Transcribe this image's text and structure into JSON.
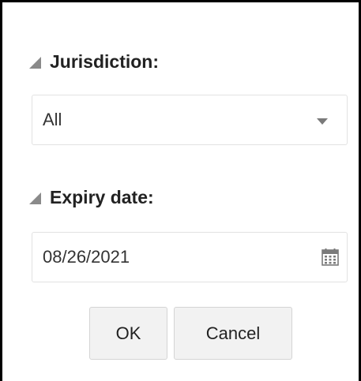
{
  "filters": {
    "jurisdiction": {
      "label": "Jurisdiction:",
      "selected_value": "All"
    },
    "expiry_date": {
      "label": "Expiry date:",
      "value": "08/26/2021"
    }
  },
  "buttons": {
    "ok_label": "OK",
    "cancel_label": "Cancel"
  },
  "icons": {
    "collapse": "triangle-collapse-icon",
    "dropdown": "chevron-down-icon",
    "calendar": "calendar-icon"
  },
  "colors": {
    "label_text": "#222222",
    "icon_gray": "#7a7a7a",
    "button_bg": "#f2f2f2",
    "input_border": "#e2e2e2"
  }
}
